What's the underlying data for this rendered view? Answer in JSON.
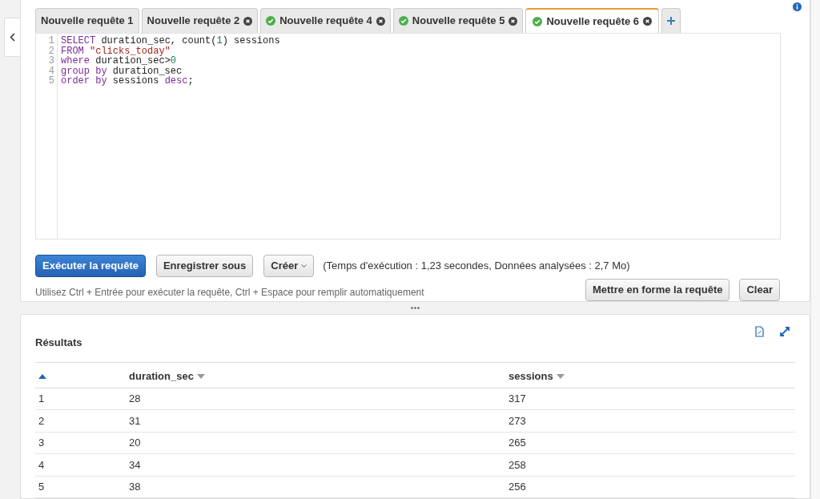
{
  "tabs": [
    {
      "label": "Nouvelle requête 1",
      "success": false,
      "closable": false,
      "selected": false
    },
    {
      "label": "Nouvelle requête 2",
      "success": false,
      "closable": true,
      "selected": false
    },
    {
      "label": "Nouvelle requête 4",
      "success": true,
      "closable": true,
      "selected": false
    },
    {
      "label": "Nouvelle requête 5",
      "success": true,
      "closable": true,
      "selected": false
    },
    {
      "label": "Nouvelle requête 6",
      "success": true,
      "closable": true,
      "selected": true
    }
  ],
  "editor": {
    "lines": [
      {
        "number": "1",
        "tokens": [
          {
            "text": "SELECT",
            "kind": "keyword"
          },
          {
            "text": " duration_sec, count(",
            "kind": "plain"
          },
          {
            "text": "1",
            "kind": "number"
          },
          {
            "text": ") sessions",
            "kind": "plain"
          }
        ]
      },
      {
        "number": "2",
        "tokens": [
          {
            "text": "FROM",
            "kind": "keyword"
          },
          {
            "text": " \"clicks_today\"",
            "kind": "string"
          }
        ]
      },
      {
        "number": "3",
        "tokens": [
          {
            "text": "where",
            "kind": "keyword"
          },
          {
            "text": " duration_sec>",
            "kind": "plain"
          },
          {
            "text": "0",
            "kind": "number"
          }
        ]
      },
      {
        "number": "4",
        "tokens": [
          {
            "text": "group by",
            "kind": "keyword"
          },
          {
            "text": " duration_sec",
            "kind": "plain"
          }
        ]
      },
      {
        "number": "5",
        "tokens": [
          {
            "text": "order by",
            "kind": "keyword"
          },
          {
            "text": " sessions ",
            "kind": "plain"
          },
          {
            "text": "desc",
            "kind": "keyword"
          },
          {
            "text": ";",
            "kind": "plain"
          }
        ]
      }
    ]
  },
  "actions": {
    "run": "Exécuter la requête",
    "save_as": "Enregistrer sous",
    "create": "Créer",
    "stats": "(Temps d'exécution : 1,23 secondes, Données analysées : 2,7 Mo)",
    "hint": "Utilisez Ctrl + Entrée pour exécuter la requête, Ctrl + Espace pour remplir automatiquement",
    "format": "Mettre en forme la requête",
    "clear": "Clear"
  },
  "results": {
    "title": "Résultats",
    "columns": [
      {
        "sorted": true
      },
      {
        "label": "duration_sec",
        "sorted": false
      },
      {
        "label": "sessions",
        "sorted": false
      }
    ],
    "rows": [
      [
        "1",
        "28",
        "317"
      ],
      [
        "2",
        "31",
        "273"
      ],
      [
        "3",
        "20",
        "265"
      ],
      [
        "4",
        "34",
        "258"
      ],
      [
        "5",
        "38",
        "256"
      ]
    ]
  }
}
